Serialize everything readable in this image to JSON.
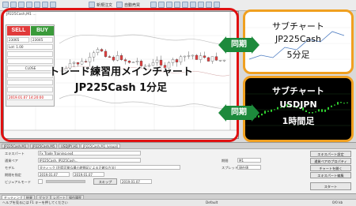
{
  "toolbar": {
    "items": [
      "新規注文",
      "自動売買"
    ]
  },
  "main_chart": {
    "symbol_line": "JP225Cash,M1 ...",
    "headline_line1": "トレード練習用メインチャート",
    "headline_line2": "JP225Cash 1分足"
  },
  "trade_panel": {
    "sell": "SELL",
    "buy": "BUY",
    "price_left": "23065",
    "price_right": "23045",
    "lot_label": "Lot: 1.00",
    "close_label": "CLOSE",
    "date_label": "2019.01.07 14:20:00"
  },
  "sync": {
    "label": "同期"
  },
  "sub_chart_1": {
    "line1": "サブチャート",
    "line2": "JP225Cash",
    "line3": "5分足"
  },
  "sub_chart_2": {
    "line1": "サブチャート",
    "line2": "USDJPN",
    "line3": "1時間足"
  },
  "chart_tabs": [
    "JP225Cash,M1",
    "JP225Cash,M5",
    "USDJPY,H1",
    "JP225Cash,M1 (visual)"
  ],
  "tester": {
    "rows": [
      {
        "label": "エキスパート",
        "value": "Fx Trade Training.ex4"
      },
      {
        "label": "通貨ペア",
        "value": "JP225Cash, JP225Cash..."
      },
      {
        "label": "モデル",
        "value": "全ティック (利用可能な最小時間足による正確な方法)"
      },
      {
        "label": "期間を指定",
        "value": "2019.01.07"
      },
      {
        "label": "ビジュアルモード",
        "value": ""
      }
    ],
    "period_label": "期間",
    "period_value": "M1",
    "spread_label": "スプレッド",
    "spread_value": "現在値",
    "skip_label": "スキップ",
    "skip_value": "2019.01.07",
    "buttons": [
      "エキスパート設定",
      "通貨ペアのプロパティ",
      "チャートを開く",
      "エキスパート編集"
    ],
    "start_button": "スタート"
  },
  "bottom_tabs": [
    "セッティング",
    "結果",
    "グラフ",
    "レポート",
    "操作履歴"
  ],
  "status": {
    "left": "ヘルプを見るには F1 キーを押してください",
    "middle": "Default",
    "right": "0/0 kb"
  },
  "colors": {
    "main_frame": "#e01010",
    "sub_frame": "#f0a020",
    "sync_badge": "#1d8a3c",
    "sell": "#e03a3a",
    "buy": "#3a9a3a"
  }
}
